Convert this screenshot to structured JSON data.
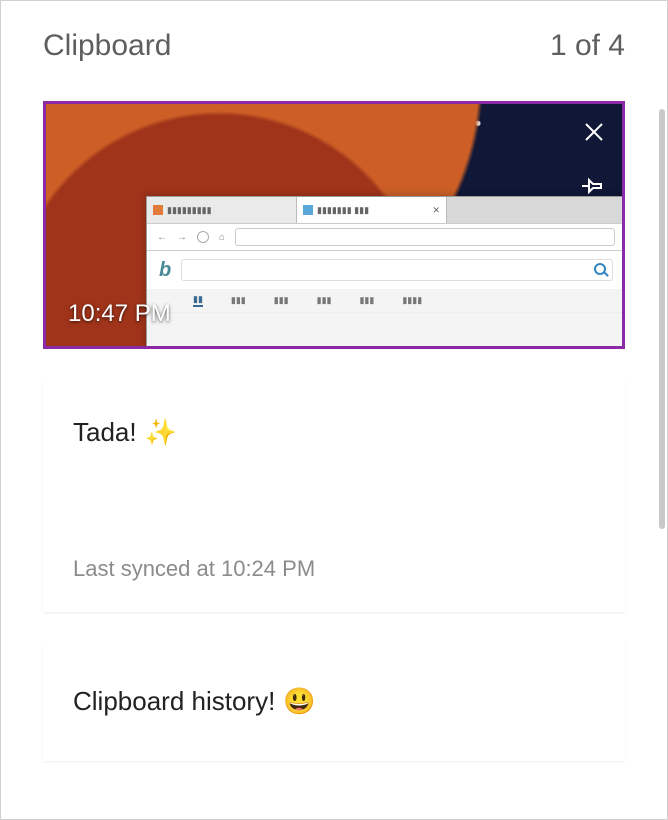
{
  "header": {
    "title": "Clipboard",
    "counter": "1 of 4"
  },
  "entries": [
    {
      "kind": "image",
      "timestamp": "10:47 PM",
      "selected": true
    },
    {
      "kind": "text",
      "content": "Tada!",
      "emoji": "✨",
      "sync_status": "Last synced at 10:24 PM"
    },
    {
      "kind": "text",
      "content": "Clipboard history!",
      "emoji": "😃"
    }
  ],
  "actions": {
    "delete": "Delete",
    "pin": "Pin"
  }
}
